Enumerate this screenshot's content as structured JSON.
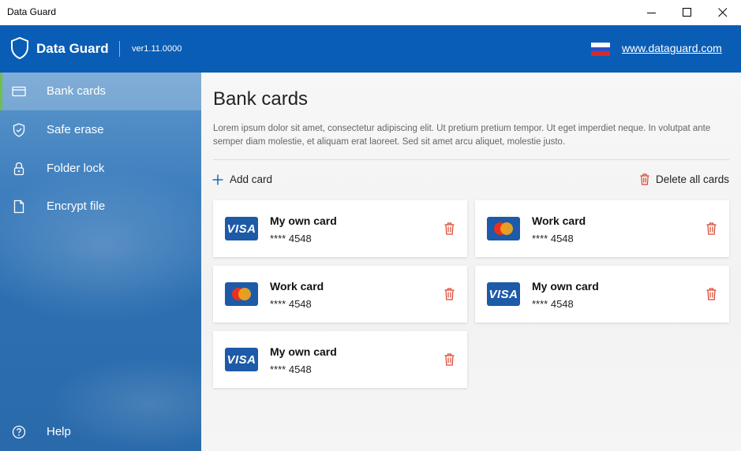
{
  "window": {
    "title": "Data Guard"
  },
  "header": {
    "app_name": "Data Guard",
    "version": "ver1.11.0000",
    "website": "www.dataguard.com"
  },
  "sidebar": {
    "items": [
      {
        "label": "Bank cards",
        "icon": "card-icon",
        "active": true
      },
      {
        "label": "Safe erase",
        "icon": "shield-check-icon",
        "active": false
      },
      {
        "label": "Folder lock",
        "icon": "lock-icon",
        "active": false
      },
      {
        "label": "Encrypt file",
        "icon": "file-icon",
        "active": false
      }
    ],
    "help_label": "Help"
  },
  "main": {
    "title": "Bank cards",
    "description": "Lorem ipsum dolor sit amet, consectetur adipiscing elit. Ut pretium pretium tempor. Ut eget imperdiet neque. In volutpat ante semper diam molestie, et aliquam erat laoreet. Sed sit amet arcu aliquet, molestie justo.",
    "add_label": "Add card",
    "delete_all_label": "Delete all cards",
    "cards": [
      {
        "name": "My own card",
        "number": "**** 4548",
        "type": "VISA"
      },
      {
        "name": "Work card",
        "number": "**** 4548",
        "type": "mastercard"
      },
      {
        "name": "Work card",
        "number": "**** 4548",
        "type": "mastercard"
      },
      {
        "name": "My own card",
        "number": "**** 4548",
        "type": "VISA"
      },
      {
        "name": "My own card",
        "number": "**** 4548",
        "type": "VISA"
      }
    ]
  },
  "colors": {
    "brand": "#0a5db5",
    "accent": "#6fbf4f",
    "delete": "#d9442e"
  }
}
